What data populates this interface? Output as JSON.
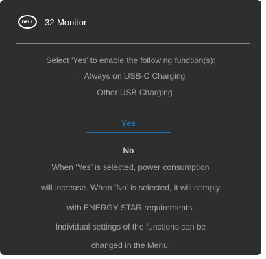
{
  "header": {
    "logo_text": "DELL",
    "title": "32 Monitor"
  },
  "dialog": {
    "prompt": "Select ‘Yes’ to enable the following function(s):",
    "functions": [
      {
        "bullet": "·",
        "label": "Always on USB-C Charging"
      },
      {
        "bullet": "·",
        "label": "Other  USB Charging"
      }
    ],
    "yes_label": "Yes",
    "no_label": "No",
    "info_lines": [
      "When ‘Yes’ is selected, power consumption",
      "will increase. When ‘No’ is selected, it will comply",
      "with ENERGY STAR requirements.",
      "Individual settings of the functions can be",
      "changed in the Menu."
    ]
  },
  "colors": {
    "panel_background": "#2e2e2e",
    "accent": "#1f79bd",
    "text_muted": "#a3a3a3",
    "text_bright": "#ffffff"
  }
}
